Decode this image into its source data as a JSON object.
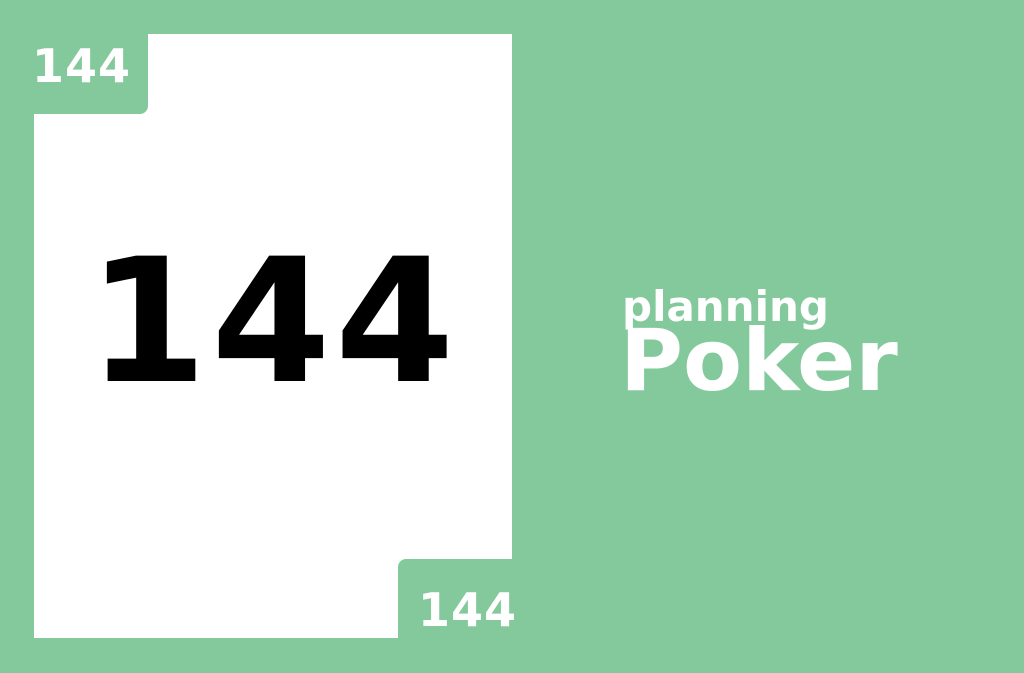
{
  "colors": {
    "background": "#84c99b",
    "card": "#ffffff",
    "card_value_text": "#000000",
    "corner_text": "#ffffff",
    "brand_text": "#ffffff"
  },
  "card": {
    "value": "144",
    "corner_top_left": "144",
    "corner_bottom_right": "144"
  },
  "brand": {
    "line1": "planning",
    "line2": "Poker"
  }
}
